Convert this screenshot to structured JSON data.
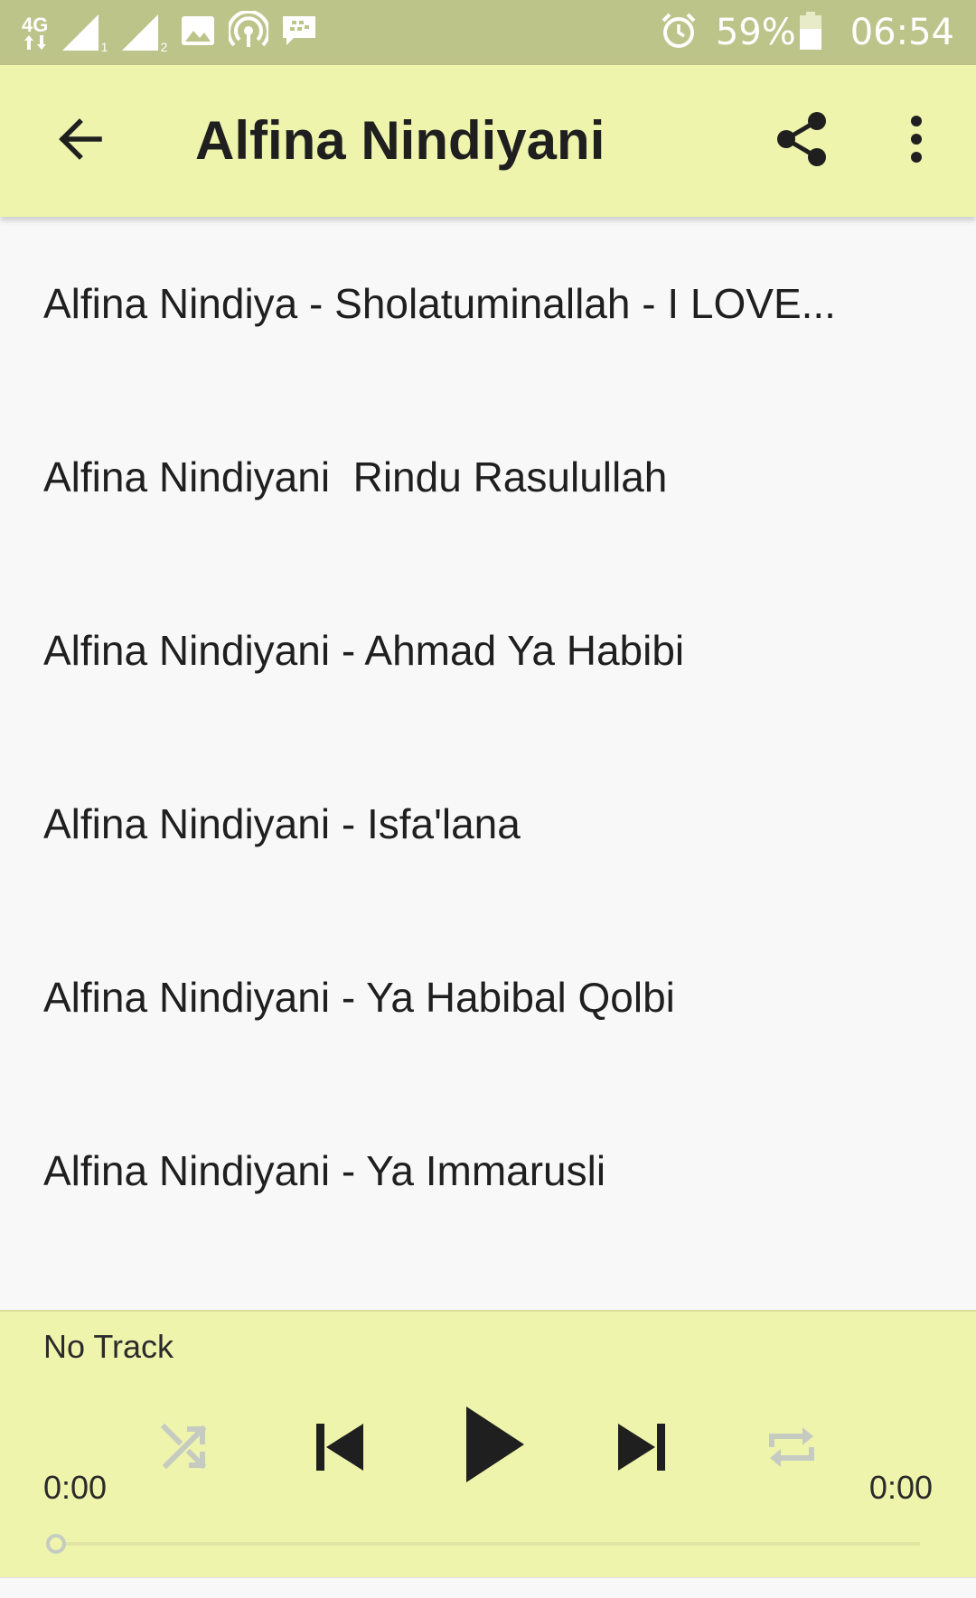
{
  "status_bar": {
    "network": "4G",
    "sim1": "1",
    "sim2": "2",
    "battery": "59%",
    "time": "06:54",
    "icons": [
      "data-arrows-icon",
      "signal-sim1-icon",
      "signal-sim2-icon",
      "image-icon",
      "hotspot-icon",
      "bbm-message-icon",
      "alarm-icon",
      "battery-icon"
    ]
  },
  "app_bar": {
    "title": "Alfina Nindiyani",
    "back_icon": "arrow-back-icon",
    "share_icon": "share-icon",
    "more_icon": "more-vert-icon"
  },
  "tracks": [
    {
      "label": "Alfina Nindiya - Sholatuminallah - I LOVE..."
    },
    {
      "label": "Alfina Nindiyani  Rindu Rasulullah"
    },
    {
      "label": "Alfina Nindiyani - Ahmad Ya Habibi"
    },
    {
      "label": "Alfina Nindiyani - Isfa'lana"
    },
    {
      "label": "Alfina Nindiyani - Ya Habibal Qolbi"
    },
    {
      "label": "Alfina Nindiyani - Ya Immarusli"
    }
  ],
  "player": {
    "now_playing": "No Track",
    "elapsed": "0:00",
    "duration": "0:00",
    "progress": 0,
    "controls": [
      "shuffle-icon",
      "skip-previous-icon",
      "play-icon",
      "skip-next-icon",
      "repeat-icon"
    ]
  },
  "colors": {
    "status_bar": "#bdc48a",
    "app_bar": "#eef4ac",
    "background": "#f8f8f8",
    "text": "#1f1f1f",
    "disabled_icon": "#c6cbc2"
  }
}
